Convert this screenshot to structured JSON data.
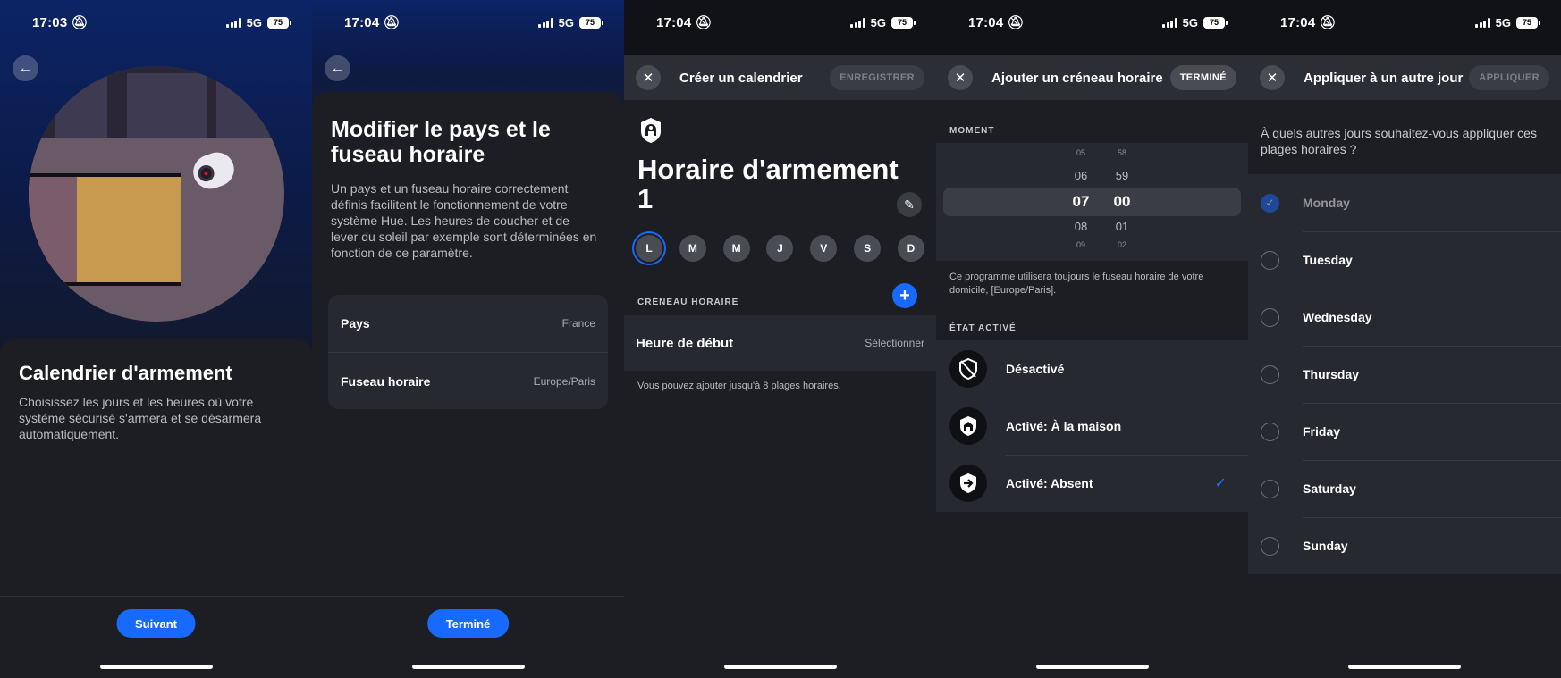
{
  "screens": [
    {
      "time": "17:03",
      "network": "5G",
      "battery": "75",
      "title": "Calendrier d'armement",
      "description": "Choisissez les jours et les heures où votre système sécurisé s'armera et se désarmera automatiquement.",
      "button": "Suivant"
    },
    {
      "time": "17:04",
      "network": "5G",
      "battery": "75",
      "title": "Modifier le pays et le fuseau horaire",
      "description": "Un pays et un fuseau horaire correctement définis facilitent le fonctionnement de votre système Hue. Les heures de coucher et de lever du soleil par exemple sont déterminées en fonction de ce paramètre.",
      "rows": [
        {
          "label": "Pays",
          "value": "France"
        },
        {
          "label": "Fuseau horaire",
          "value": "Europe/Paris"
        }
      ],
      "button": "Terminé"
    },
    {
      "time": "17:04",
      "network": "5G",
      "battery": "75",
      "header_title": "Créer un calendrier",
      "header_action": "ENREGISTRER",
      "schedule_name": "Horaire d'armement 1",
      "days": [
        "L",
        "M",
        "M",
        "J",
        "V",
        "S",
        "D"
      ],
      "selected_day_index": 0,
      "section_label": "CRÉNEAU HORAIRE",
      "start_label": "Heure de début",
      "start_value": "Sélectionner",
      "hint": "Vous pouvez ajouter jusqu'à 8 plages horaires."
    },
    {
      "time": "17:04",
      "network": "5G",
      "battery": "75",
      "header_title": "Ajouter un créneau horaire",
      "header_action": "TERMINÉ",
      "moment_label": "MOMENT",
      "picker": {
        "hours": [
          "05",
          "06",
          "07",
          "08",
          "09"
        ],
        "minutes": [
          "58",
          "59",
          "00",
          "01",
          "02"
        ]
      },
      "tz_hint": "Ce programme utilisera toujours le fuseau horaire de votre domicile, [Europe/Paris].",
      "state_label": "ÉTAT ACTIVÉ",
      "states": [
        {
          "label": "Désactivé",
          "icon": "shield-off-icon",
          "checked": false
        },
        {
          "label": "Activé: À la maison",
          "icon": "shield-home-icon",
          "checked": false
        },
        {
          "label": "Activé: Absent",
          "icon": "shield-away-icon",
          "checked": true
        }
      ]
    },
    {
      "time": "17:04",
      "network": "5G",
      "battery": "75",
      "header_title": "Appliquer à un autre jour",
      "header_action": "APPLIQUER",
      "question": "À quels autres jours souhaitez-vous appliquer ces plages horaires ?",
      "days": [
        {
          "name": "Monday",
          "checked": true,
          "disabled": true
        },
        {
          "name": "Tuesday",
          "checked": false,
          "disabled": false
        },
        {
          "name": "Wednesday",
          "checked": false,
          "disabled": false
        },
        {
          "name": "Thursday",
          "checked": false,
          "disabled": false
        },
        {
          "name": "Friday",
          "checked": false,
          "disabled": false
        },
        {
          "name": "Saturday",
          "checked": false,
          "disabled": false
        },
        {
          "name": "Sunday",
          "checked": false,
          "disabled": false
        }
      ]
    }
  ],
  "colors": {
    "accent": "#1769ff",
    "background": "#1c1e24",
    "surface": "#272930"
  }
}
